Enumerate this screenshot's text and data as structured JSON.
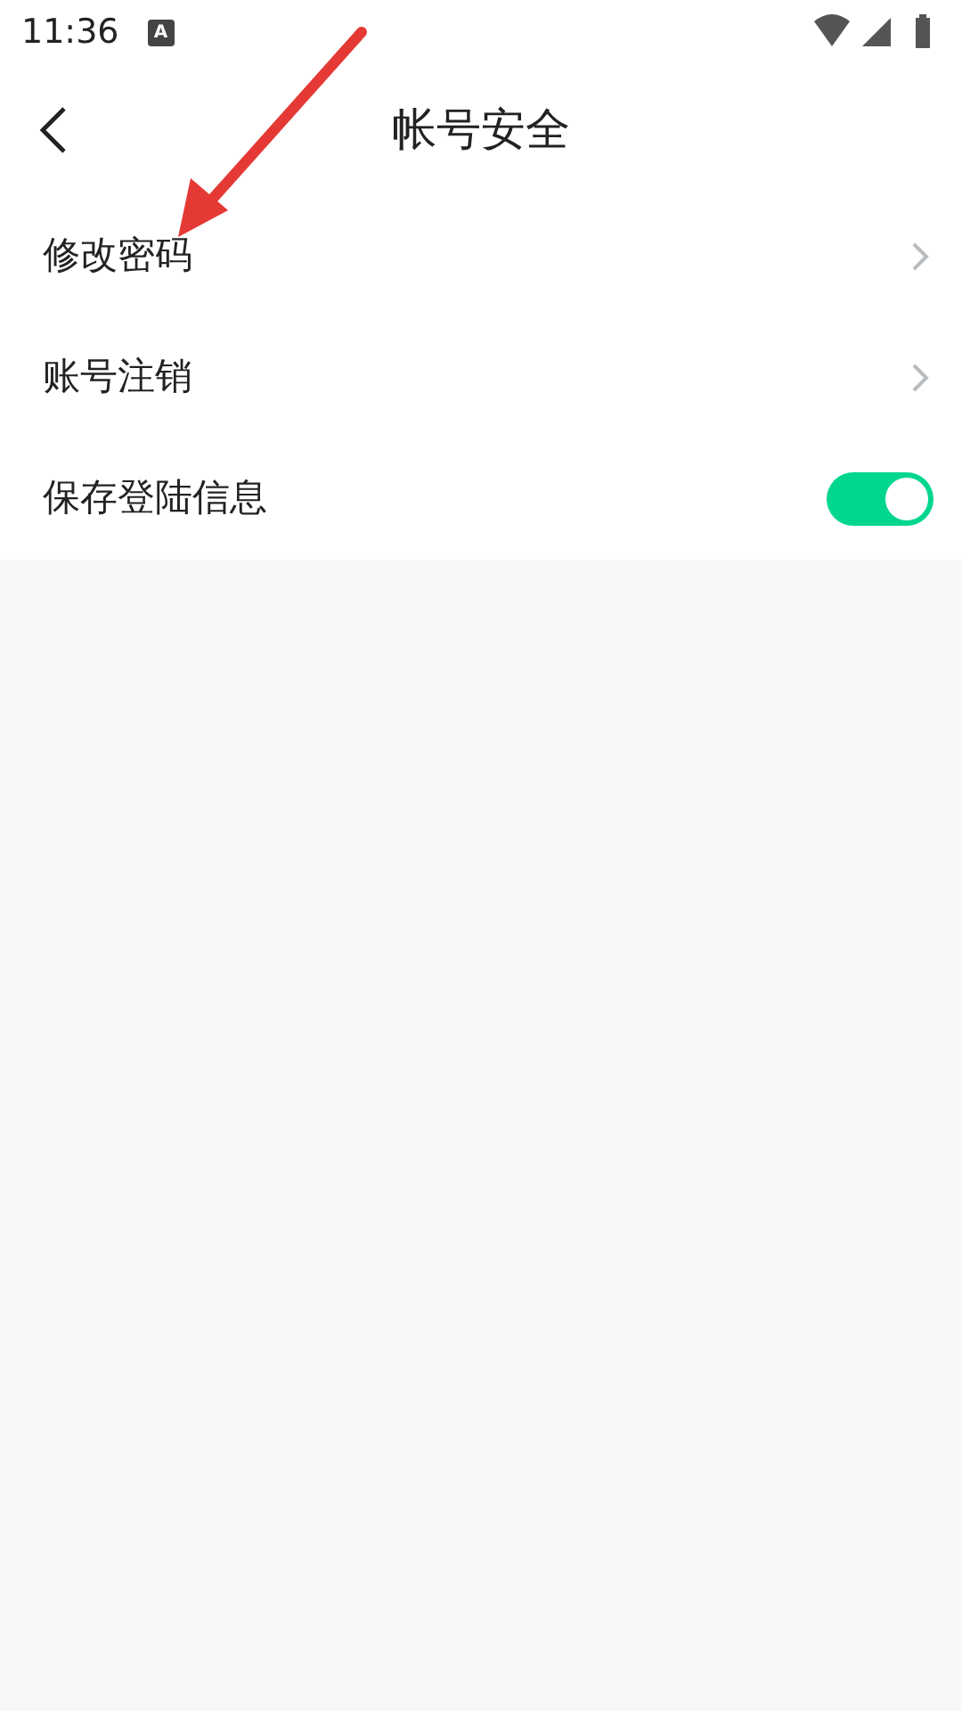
{
  "status_bar": {
    "time": "11:36",
    "notification": "A"
  },
  "header": {
    "title": "帐号安全"
  },
  "items": [
    {
      "kind": "link",
      "label": "修改密码"
    },
    {
      "kind": "link",
      "label": "账号注销"
    },
    {
      "kind": "toggle",
      "label": "保存登陆信息",
      "on": true
    }
  ],
  "annotation": {
    "kind": "arrow"
  }
}
